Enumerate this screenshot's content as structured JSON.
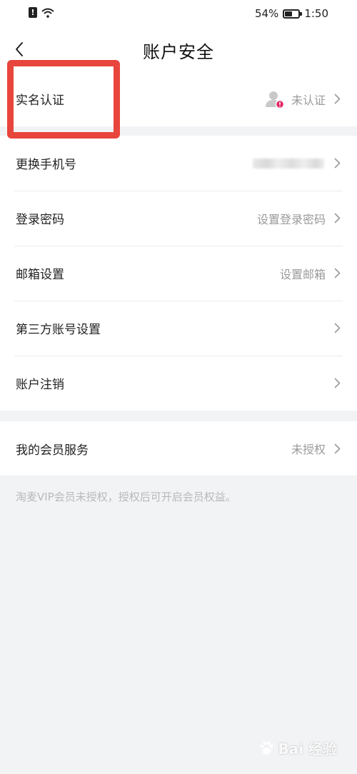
{
  "status_bar": {
    "battery_percent": "54%",
    "battery_level": 0.54,
    "time": "1:50"
  },
  "header": {
    "title": "账户安全"
  },
  "rows": {
    "realname": {
      "label": "实名认证",
      "value": "未认证"
    },
    "phone": {
      "label": "更换手机号"
    },
    "password": {
      "label": "登录密码",
      "value": "设置登录密码"
    },
    "email": {
      "label": "邮箱设置",
      "value": "设置邮箱"
    },
    "third_party": {
      "label": "第三方账号设置"
    },
    "cancel_account": {
      "label": "账户注销"
    },
    "membership": {
      "label": "我的会员服务",
      "value": "未授权"
    }
  },
  "footer_note": "淘麦VIP会员未授权，授权后可开启会员权益。",
  "watermark": {
    "text": "Bai 经验"
  },
  "colors": {
    "highlight": "#e8453c",
    "badge": "#e0245e",
    "background": "#f2f3f5"
  }
}
